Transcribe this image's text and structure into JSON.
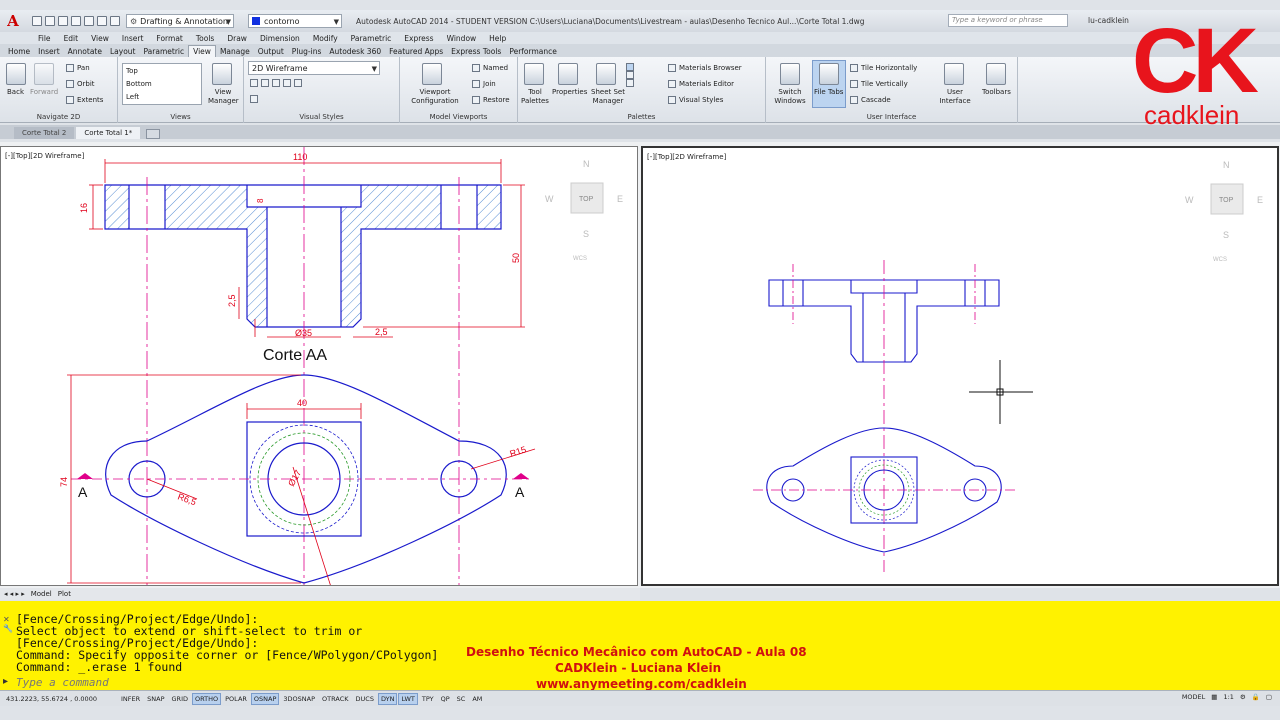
{
  "app": {
    "logo_letter": "A",
    "workspace": "Drafting & Annotation",
    "layer": "contorno",
    "title": "Autodesk AutoCAD 2014 - STUDENT VERSION   C:\\Users\\Luciana\\Documents\\Livestream - aulas\\Desenho Tecnico Aul...\\Corte Total 1.dwg",
    "search_placeholder": "Type a keyword or phrase",
    "user": "lu-cadklein"
  },
  "menu": [
    "File",
    "Edit",
    "View",
    "Insert",
    "Format",
    "Tools",
    "Draw",
    "Dimension",
    "Modify",
    "Parametric",
    "Express",
    "Window",
    "Help"
  ],
  "ribbon_tabs": [
    "Home",
    "Insert",
    "Annotate",
    "Layout",
    "Parametric",
    "View",
    "Manage",
    "Output",
    "Plug-ins",
    "Autodesk 360",
    "Featured Apps",
    "Express Tools",
    "Performance"
  ],
  "ribbon_active_tab": "View",
  "ribbon": {
    "navigate": {
      "title": "Navigate 2D",
      "back": "Back",
      "forward": "Forward",
      "pan": "Pan",
      "orbit": "Orbit",
      "extents": "Extents"
    },
    "views": {
      "title": "Views",
      "items": [
        "Top",
        "Bottom",
        "Left"
      ],
      "view_manager": "View Manager"
    },
    "visual_styles": {
      "title": "Visual Styles",
      "current": "2D Wireframe"
    },
    "model_viewports": {
      "title": "Model Viewports",
      "viewport_config": "Viewport Configuration",
      "named": "Named",
      "join": "Join",
      "restore": "Restore"
    },
    "palettes": {
      "title": "Palettes",
      "tool_palettes": "Tool Palettes",
      "properties": "Properties",
      "sheet_set": "Sheet Set Manager",
      "materials_browser": "Materials Browser",
      "materials_editor": "Materials Editor",
      "visual_styles": "Visual Styles"
    },
    "user_interface": {
      "title": "User Interface",
      "switch_windows": "Switch Windows",
      "file_tabs": "File Tabs",
      "tile_h": "Tile Horizontally",
      "tile_v": "Tile Vertically",
      "cascade": "Cascade",
      "user_interface": "User Interface",
      "toolbars": "Toolbars"
    }
  },
  "file_tabs": [
    "Corte Total 2",
    "Corte Total 1*"
  ],
  "viewports": {
    "left_label": "[-][Top][2D Wireframe]",
    "right_label": "[-][Top][2D Wireframe]",
    "viewcube": {
      "n": "N",
      "s": "S",
      "e": "E",
      "w": "W",
      "face": "TOP",
      "wcs": "WCS"
    }
  },
  "drawing": {
    "section_title": "Corte AA",
    "dims": {
      "d110": "110",
      "d16": "16",
      "d8": "8",
      "d50": "50",
      "d25a": "2,5",
      "d25b": "2,5",
      "d35": "Ø35",
      "d40": "40",
      "d74": "74",
      "r15": "R15",
      "r65": "R6,5",
      "r17": "Ø17"
    },
    "section_marker": "A"
  },
  "layout_tabs": [
    "Model",
    "Plot"
  ],
  "command": {
    "lines": [
      "[Fence/Crossing/Project/Edge/Undo]:",
      "Select object to extend or shift-select to trim or",
      "[Fence/Crossing/Project/Edge/Undo]:",
      "Command: Specify opposite corner or [Fence/WPolygon/CPolygon]",
      "Command: _.erase 1 found"
    ],
    "placeholder": "Type a command"
  },
  "banner": {
    "line1": "Desenho Técnico Mecânico com AutoCAD - Aula 08",
    "line2": "CADKlein - Luciana Klein",
    "line3": "www.anymeeting.com/cadklein"
  },
  "status": {
    "coords": "431.2223, 55.6724 , 0.0000",
    "buttons": [
      {
        "label": "INFER",
        "on": false
      },
      {
        "label": "SNAP",
        "on": false
      },
      {
        "label": "GRID",
        "on": false
      },
      {
        "label": "ORTHO",
        "on": true
      },
      {
        "label": "POLAR",
        "on": false
      },
      {
        "label": "OSNAP",
        "on": true
      },
      {
        "label": "3DOSNAP",
        "on": false
      },
      {
        "label": "OTRACK",
        "on": false
      },
      {
        "label": "DUCS",
        "on": false
      },
      {
        "label": "DYN",
        "on": true
      },
      {
        "label": "LWT",
        "on": true
      },
      {
        "label": "TPY",
        "on": false
      },
      {
        "label": "QP",
        "on": false
      },
      {
        "label": "SC",
        "on": false
      },
      {
        "label": "AM",
        "on": false
      }
    ],
    "model": "MODEL",
    "scale": "1:1"
  },
  "watermark": {
    "ck": "CK",
    "brand": "cadklein"
  },
  "colors": {
    "geometry": "#1a1acc",
    "center": "#e0008a",
    "dimension": "#e0001a",
    "hatch": "#2a70c8",
    "banner": "#d01010",
    "cmd_bg": "#fff200"
  }
}
